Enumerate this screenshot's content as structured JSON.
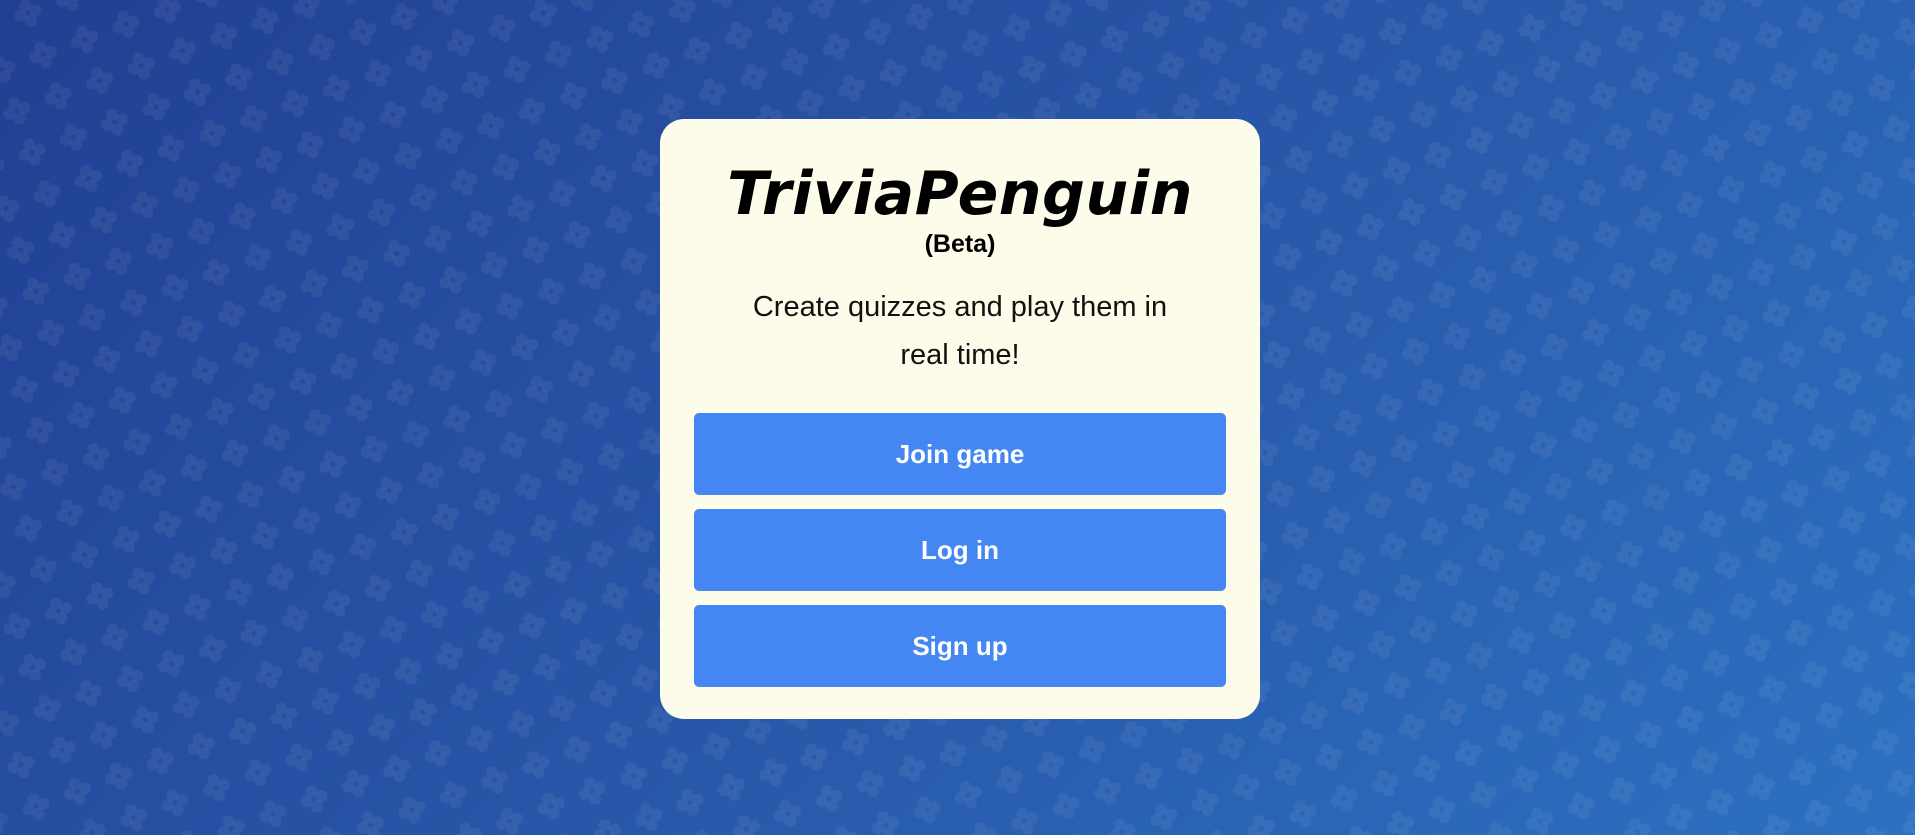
{
  "app": {
    "title": "TriviaPenguin",
    "badge": "(Beta)",
    "tagline": "Create quizzes and play them in real time!"
  },
  "actions": {
    "join_label": "Join game",
    "login_label": "Log in",
    "signup_label": "Sign up"
  },
  "colors": {
    "background_start": "#213f93",
    "background_end": "#2c71c1",
    "card": "#fdfcea",
    "button": "#4587f2",
    "button_text": "#ffffff"
  },
  "background_pattern": {
    "icon": "flower-pattern-icon"
  }
}
